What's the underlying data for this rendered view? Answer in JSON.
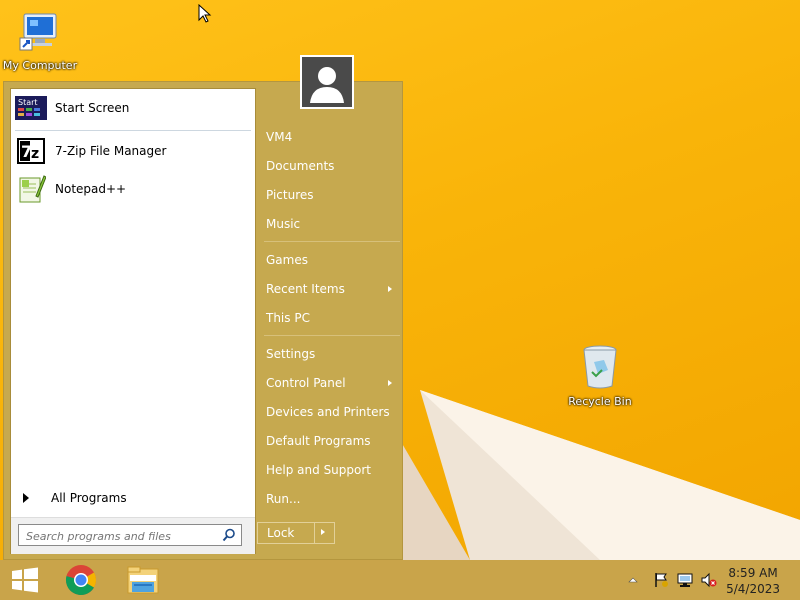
{
  "desktop": {
    "icons": [
      {
        "label": "My Computer",
        "icon": "computer-icon"
      },
      {
        "label": "Recycle Bin",
        "icon": "recycle-bin-icon"
      }
    ]
  },
  "start_menu": {
    "pinned": [
      {
        "label": "Start Screen",
        "icon": "start-screen-icon"
      },
      {
        "label": "7-Zip File Manager",
        "icon": "7zip-icon"
      },
      {
        "label": "Notepad++",
        "icon": "notepad-plus-plus-icon"
      }
    ],
    "all_programs": "All Programs",
    "search_placeholder": "Search programs and files",
    "right_items": [
      {
        "label": "VM4"
      },
      {
        "label": "Documents"
      },
      {
        "label": "Pictures"
      },
      {
        "label": "Music"
      },
      {
        "label": "Games"
      },
      {
        "label": "Recent Items",
        "submenu": true
      },
      {
        "label": "This PC"
      },
      {
        "label": "Settings"
      },
      {
        "label": "Control Panel",
        "submenu": true
      },
      {
        "label": "Devices and Printers"
      },
      {
        "label": "Default Programs"
      },
      {
        "label": "Help and Support"
      },
      {
        "label": "Run..."
      }
    ],
    "lock_label": "Lock",
    "start_icon_text": "Start"
  },
  "taskbar": {
    "buttons": [
      "windows-start-icon",
      "chrome-icon",
      "file-explorer-icon"
    ],
    "tray_icons": [
      "show-hidden-icons-icon",
      "action-center-flag-icon",
      "network-icon",
      "volume-muted-icon"
    ],
    "time": "8:59 AM",
    "date": "5/4/2023"
  },
  "colors": {
    "menu_bg": "#c6a94f",
    "taskbar_bg": "#c9a44a",
    "desktop_bg": "#f6b300"
  }
}
